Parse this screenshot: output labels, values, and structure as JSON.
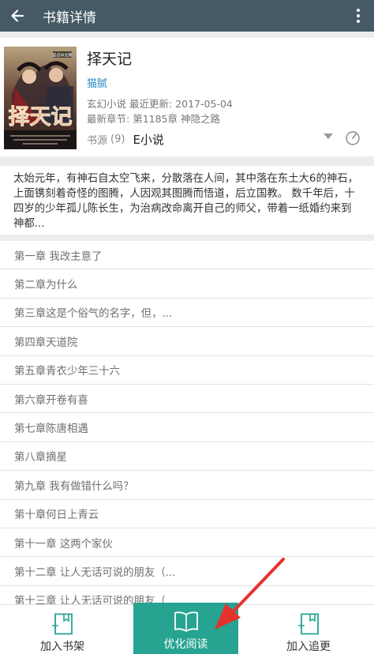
{
  "topbar": {
    "title": "书籍详情",
    "back_icon": "back-arrow-icon",
    "more_icon": "more-vertical-icon"
  },
  "book": {
    "title": "择天记",
    "author": "猫腻",
    "category": "玄幻小说",
    "updated_label": "最近更新:",
    "updated_date": "2017-05-04",
    "latest_label": "最新章节:",
    "latest_chapter": "第1185章 神隐之路",
    "source_label": "书源",
    "source_count": "(9)",
    "source_name": "E小说",
    "cover_text": "择天记",
    "cover_badge": "起点中文网"
  },
  "description": "太始元年，有神石自太空飞来，分散落在人间，其中落在东土大6的神石，上面镌刻着奇怪的图腾，人因观其图腾而悟道，后立国教。 数千年后，十四岁的少年孤儿陈长生，为治病改命离开自己的师父，带着一纸婚约来到神都...",
  "chapters": [
    "第一章 我改主意了",
    "第二章为什么",
    "第三章这是个俗气的名字，但，...",
    "第四章天道院",
    "第五章青衣少年三十六",
    "第六章开卷有喜",
    "第七章陈唐相遇",
    "第八章摘星",
    "第九章 我有做错什么吗？",
    "第十章何日上青云",
    "第十一章 这两个家伙",
    "第十二章 让人无话可说的朋友（...",
    "第十三章 让人无话可说的朋友（..."
  ],
  "bottom_bar": {
    "add_shelf": "加入书架",
    "optimized_read": "优化阅读",
    "add_follow": "加入追更"
  },
  "colors": {
    "topbar": "#455a64",
    "accent": "#26a391",
    "author": "#2b87c5",
    "annotation_arrow": "#e5322d"
  }
}
